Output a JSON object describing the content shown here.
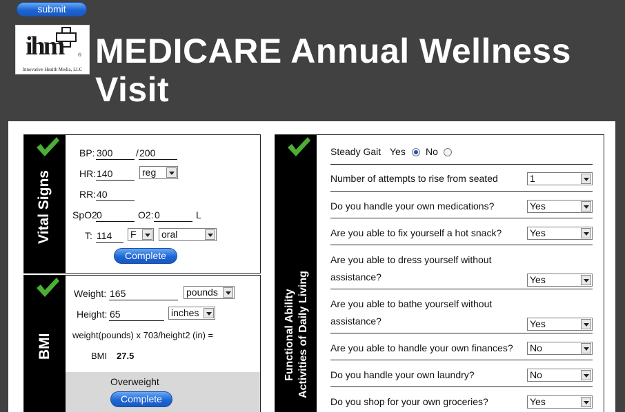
{
  "header": {
    "submit_label": "submit",
    "logo": {
      "mark": "ihm",
      "caption": "Innovative Health Media, LLC"
    },
    "title": "MEDICARE Annual Wellness Visit"
  },
  "vitals": {
    "section_title": "Vital Signs",
    "bp": {
      "label": "BP:",
      "systolic": "300",
      "separator": "/",
      "diastolic": "200"
    },
    "hr": {
      "label": "HR:",
      "value": "140",
      "rhythm": "reg"
    },
    "rr": {
      "label": "RR:",
      "value": "40"
    },
    "spo2": {
      "label": "SpO2",
      "value": "0"
    },
    "o2": {
      "label": "O2:",
      "value": "0",
      "unit": "L"
    },
    "temp": {
      "label": "T:",
      "value": "114",
      "scale": "F",
      "route": "oral"
    },
    "complete_label": "Complete"
  },
  "bmi": {
    "section_title": "BMI",
    "weight": {
      "label": "Weight:",
      "value": "165",
      "unit": "pounds"
    },
    "height": {
      "label": "Height:",
      "value": "65",
      "unit": "inches"
    },
    "formula": "weight(pounds) x 703/height2 (in) =",
    "result_label": "BMI",
    "result_value": "27.5",
    "category": "Overweight",
    "complete_label": "Complete"
  },
  "functional": {
    "section_title_line1": "Functional Ability",
    "section_title_line2": "Activities of Daily Living",
    "steady_gait": {
      "question": "Steady Gait",
      "yes_label": "Yes",
      "no_label": "No",
      "selected": "Yes"
    },
    "questions": [
      {
        "q1": "Number of attempts to rise from seated",
        "q2": "",
        "answer": "1"
      },
      {
        "q1": "Do you handle your own medications?",
        "q2": "",
        "answer": "Yes"
      },
      {
        "q1": "Are you able to fix yourself a hot snack?",
        "q2": "",
        "answer": "Yes"
      },
      {
        "q1": "Are you able to dress yourself without",
        "q2": "assistance?",
        "answer": "Yes"
      },
      {
        "q1": "Are you able to bathe yourself without",
        "q2": "assistance?",
        "answer": "Yes"
      },
      {
        "q1": "Are you able to handle your own finances?",
        "q2": "",
        "answer": "No"
      },
      {
        "q1": "Do you handle your own laundry?",
        "q2": "",
        "answer": "No"
      },
      {
        "q1": "Do you shop for your own groceries?",
        "q2": "",
        "answer": "Yes"
      }
    ]
  },
  "colors": {
    "background": "#414141",
    "check_green": "#4caf35",
    "button_blue": "#1d66d6",
    "section_black": "#000000"
  }
}
